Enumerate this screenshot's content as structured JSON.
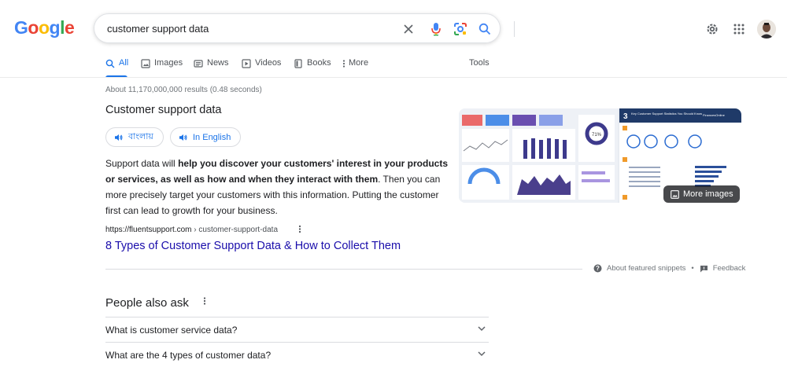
{
  "logo": {
    "letters": [
      "G",
      "o",
      "o",
      "g",
      "l",
      "e"
    ],
    "colors": [
      "#4285f4",
      "#ea4335",
      "#fbbc05",
      "#4285f4",
      "#34a853",
      "#ea4335"
    ]
  },
  "search": {
    "query": "customer support data"
  },
  "tabs": [
    {
      "label": "All",
      "icon": "search-icon"
    },
    {
      "label": "Images",
      "icon": "image-icon"
    },
    {
      "label": "News",
      "icon": "news-icon"
    },
    {
      "label": "Videos",
      "icon": "video-icon"
    },
    {
      "label": "Books",
      "icon": "book-icon"
    },
    {
      "label": "More",
      "icon": "more-vert-icon"
    }
  ],
  "tools_label": "Tools",
  "results_count": "About 11,170,000,000 results (0.48 seconds)",
  "snippet": {
    "title": "Customer support data",
    "lang_buttons": [
      "বাংলায়",
      "In English"
    ],
    "body_parts": [
      {
        "text": "Support data will ",
        "bold": false
      },
      {
        "text": "help you discover your customers' interest in your products or services, as well as how and when they interact with them",
        "bold": true
      },
      {
        "text": ". Then you can more precisely target your customers with this information. Putting the customer first can lead to growth for your business.",
        "bold": false
      }
    ],
    "more_images_label": "More images",
    "source_domain": "https://fluentsupport.com",
    "source_path": " › customer-support-data",
    "link_title": "8 Types of Customer Support Data & How to Collect Them",
    "about_label": "About featured snippets",
    "feedback_label": "Feedback",
    "image_texts": {
      "tile1": "3",
      "tile2_title": "Key Customer Support Statistics You Should Know",
      "brand": "FinancesOnline",
      "gauge": "71%"
    }
  },
  "paa": {
    "title": "People also ask",
    "questions": [
      "What is customer service data?",
      "What are the 4 types of customer data?"
    ]
  },
  "colors": {
    "accent": "#1a73e8",
    "link": "#1a0dab"
  }
}
